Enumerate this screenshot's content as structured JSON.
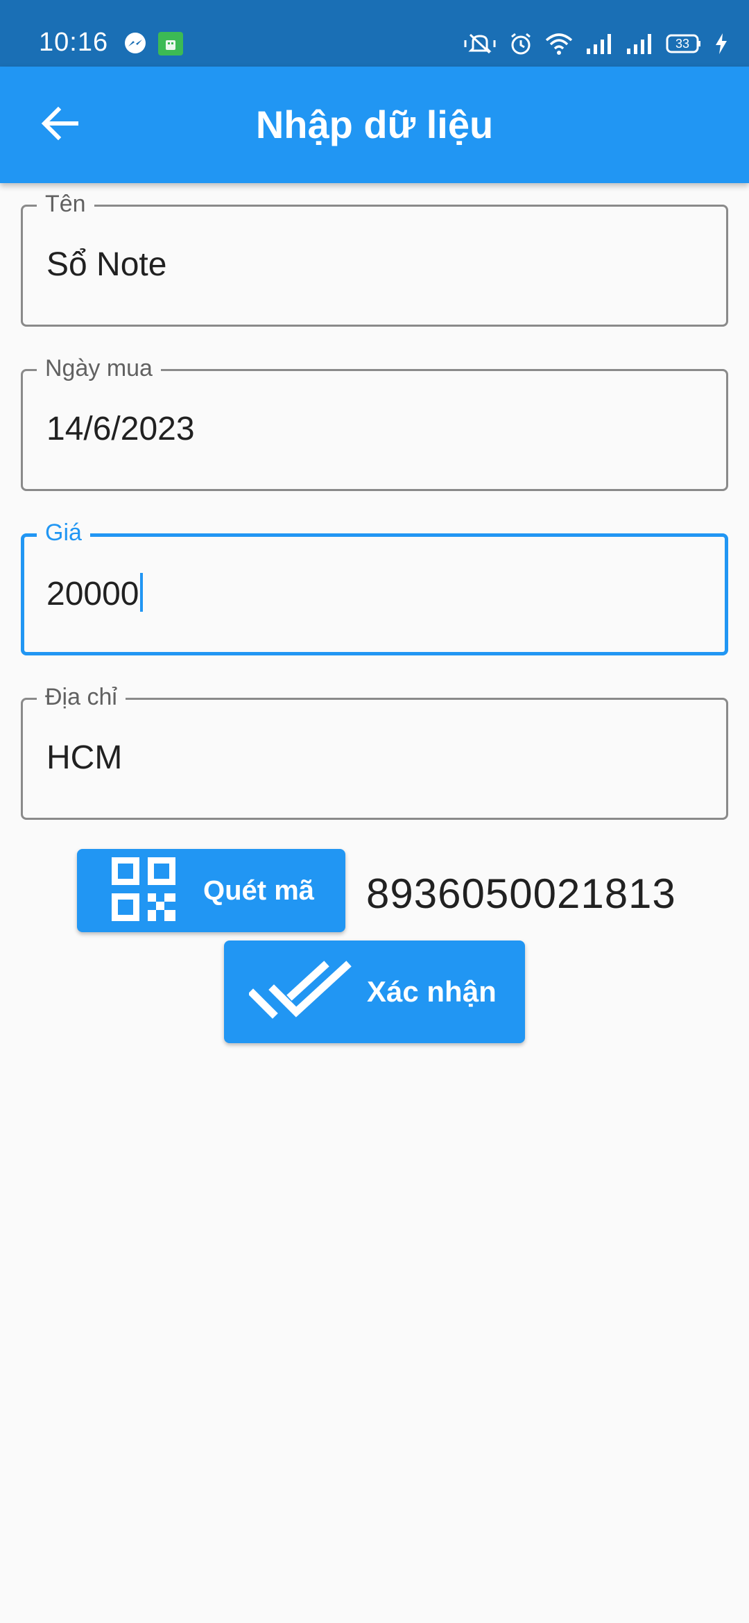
{
  "status_bar": {
    "time": "10:16",
    "battery": "33",
    "left_icons": [
      "messenger-icon",
      "android-app-icon"
    ],
    "right_icons": [
      "mute-vibrate-icon",
      "alarm-icon",
      "wifi-icon",
      "signal-icon",
      "signal-icon",
      "battery-icon",
      "charging-icon"
    ]
  },
  "app_bar": {
    "title": "Nhập dữ liệu",
    "back_icon": "arrow-left-icon",
    "color": "#2196f3"
  },
  "form": {
    "fields": [
      {
        "label": "Tên",
        "value": "Sổ Note"
      },
      {
        "label": "Ngày mua",
        "value": "14/6/2023"
      },
      {
        "label": "Giá",
        "value": "20000",
        "focused": true
      },
      {
        "label": "Địa chỉ",
        "value": "HCM"
      }
    ]
  },
  "scan": {
    "label": "Quét mã",
    "icon": "qr-code-icon",
    "result": "8936050021813"
  },
  "confirm": {
    "label": "Xác nhận",
    "icon": "double-check-icon"
  },
  "colors": {
    "accent": "#2196f3",
    "status_bar": "#1a6fb5",
    "border": "#8a8a8a",
    "text": "#212121"
  }
}
